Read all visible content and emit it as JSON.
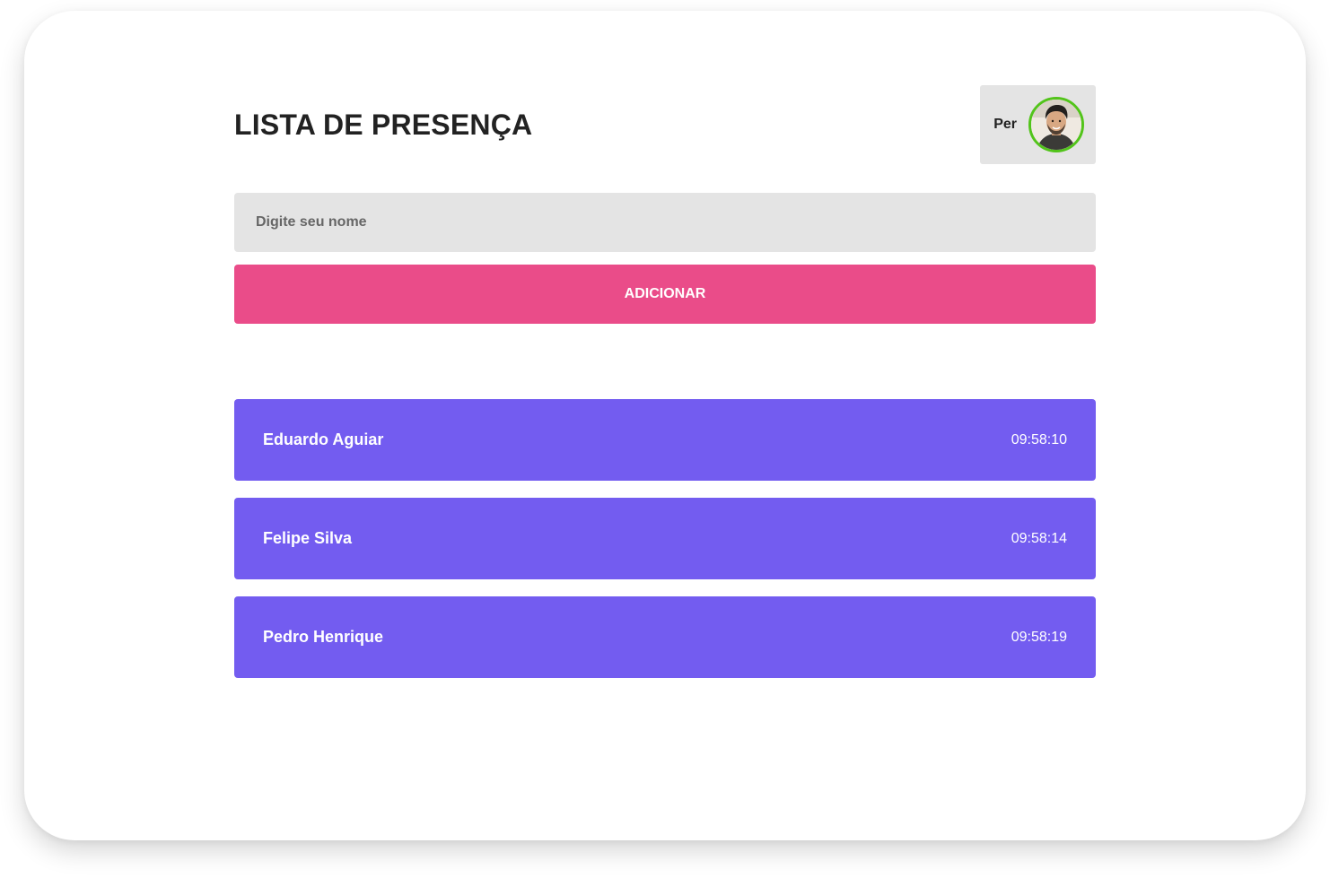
{
  "app": {
    "title": "LISTA DE PRESENÇA"
  },
  "profile": {
    "name": "Per",
    "avatar_icon": "user-avatar-photo",
    "avatar_border_color": "#52c41a"
  },
  "form": {
    "name_input": {
      "placeholder": "Digite seu nome",
      "value": ""
    },
    "add_button_label": "ADICIONAR",
    "add_button_color": "#ea4c89"
  },
  "attendees": [
    {
      "name": "Eduardo Aguiar",
      "time": "09:58:10"
    },
    {
      "name": "Felipe Silva",
      "time": "09:58:14"
    },
    {
      "name": "Pedro Henrique",
      "time": "09:58:19"
    }
  ],
  "colors": {
    "card_background": "#735cf0",
    "input_background": "#e4e4e4",
    "title_text": "#222222"
  }
}
